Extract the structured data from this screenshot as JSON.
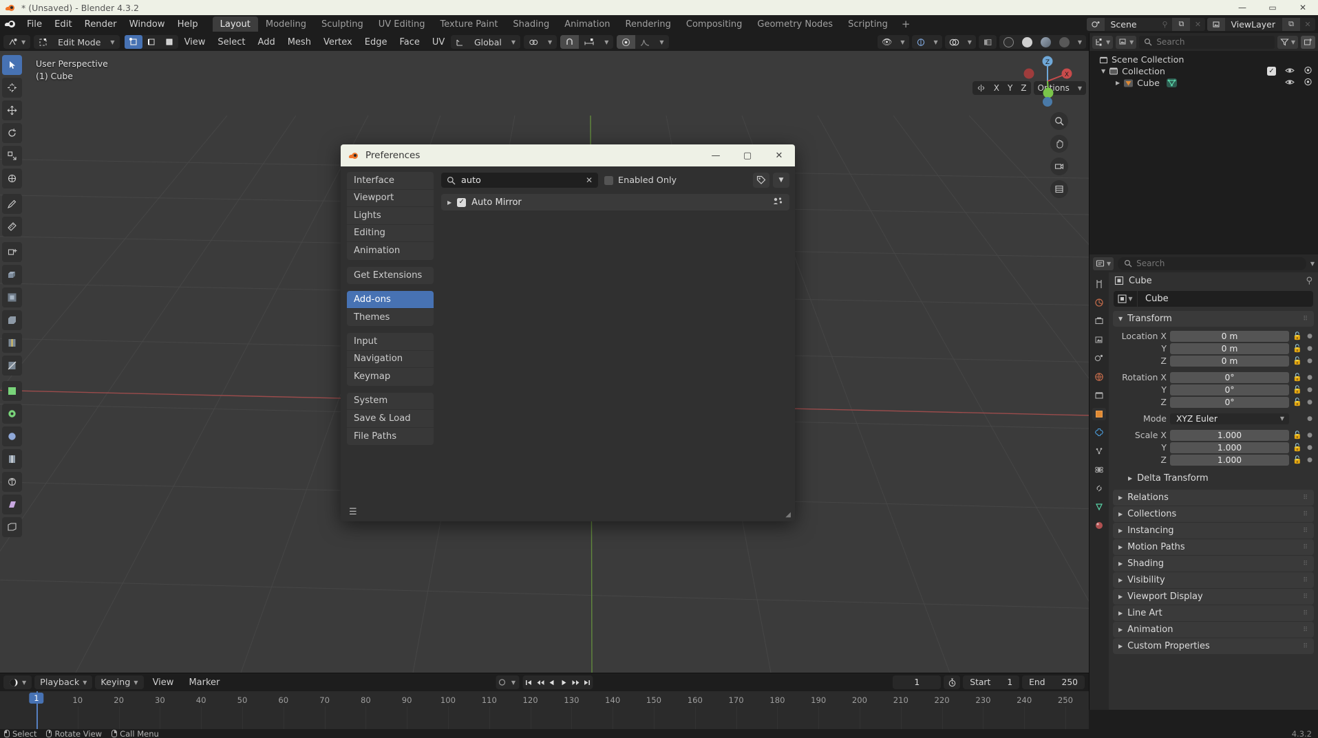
{
  "window": {
    "title": "* (Unsaved) - Blender 4.3.2",
    "minimize": "—",
    "maximize": "▭",
    "close": "✕"
  },
  "topbar": {
    "menus": [
      "File",
      "Edit",
      "Render",
      "Window",
      "Help"
    ],
    "workspaces": [
      {
        "label": "Layout",
        "active": true
      },
      {
        "label": "Modeling",
        "active": false
      },
      {
        "label": "Sculpting",
        "active": false
      },
      {
        "label": "UV Editing",
        "active": false
      },
      {
        "label": "Texture Paint",
        "active": false
      },
      {
        "label": "Shading",
        "active": false
      },
      {
        "label": "Animation",
        "active": false
      },
      {
        "label": "Rendering",
        "active": false
      },
      {
        "label": "Compositing",
        "active": false
      },
      {
        "label": "Geometry Nodes",
        "active": false
      },
      {
        "label": "Scripting",
        "active": false
      }
    ],
    "add_workspace": "+",
    "scene_name": "Scene",
    "viewlayer_name": "ViewLayer",
    "new_scene_icon": "⧉",
    "remove_scene_icon": "✕",
    "new_viewlayer_icon": "⧉",
    "remove_viewlayer_icon": "✕",
    "pin_icon": "⚲"
  },
  "viewport": {
    "mode": "Edit Mode",
    "menus": [
      "View",
      "Select",
      "Add",
      "Mesh",
      "Vertex",
      "Edge",
      "Face",
      "UV"
    ],
    "orientation": "Global",
    "overlay_line1": "User Perspective",
    "overlay_line2": "(1) Cube",
    "options_label": "Options",
    "axis_x": "X",
    "axis_y": "Y",
    "axis_z": "Z",
    "gizmo_x": "X",
    "gizmo_y": "Y",
    "gizmo_z": "Z"
  },
  "outliner": {
    "search_placeholder": "Search",
    "rows": [
      {
        "label": "Scene Collection",
        "level": 0,
        "icon": "collection-icon",
        "expand": "",
        "has_toggles": false
      },
      {
        "label": "Collection",
        "level": 1,
        "icon": "collection-icon",
        "expand": "▼",
        "has_toggles": true,
        "checkbox": true
      },
      {
        "label": "Cube",
        "level": 2,
        "icon": "mesh-object-icon",
        "expand": "▶",
        "has_toggles": true,
        "checkbox": false
      }
    ],
    "eye_icon": "👁",
    "camera_icon": "◉"
  },
  "properties": {
    "search_placeholder": "Search",
    "breadcrumb": "Cube",
    "id_name": "Cube",
    "transform_title": "Transform",
    "fields": [
      {
        "label": "Location X",
        "value": "0 m",
        "lock": true
      },
      {
        "label": "Y",
        "value": "0 m",
        "lock": true
      },
      {
        "label": "Z",
        "value": "0 m",
        "lock": true
      },
      {
        "label": "Rotation X",
        "value": "0°",
        "lock": true,
        "gap": true
      },
      {
        "label": "Y",
        "value": "0°",
        "lock": true
      },
      {
        "label": "Z",
        "value": "0°",
        "lock": true
      },
      {
        "label": "Mode",
        "value": "XYZ Euler",
        "lock": false,
        "dropdown": true,
        "gap": true
      },
      {
        "label": "Scale X",
        "value": "1.000",
        "lock": true,
        "gap": true
      },
      {
        "label": "Y",
        "value": "1.000",
        "lock": true
      },
      {
        "label": "Z",
        "value": "1.000",
        "lock": true
      }
    ],
    "delta_transform": "Delta Transform",
    "panels": [
      "Relations",
      "Collections",
      "Instancing",
      "Motion Paths",
      "Shading",
      "Visibility",
      "Viewport Display",
      "Line Art",
      "Animation",
      "Custom Properties"
    ]
  },
  "timeline": {
    "playback": "Playback",
    "keying": "Keying",
    "view": "View",
    "marker": "Marker",
    "current_frame": "1",
    "start_label": "Start",
    "start_value": "1",
    "end_label": "End",
    "end_value": "250",
    "ticks": [
      "1",
      "10",
      "20",
      "30",
      "40",
      "50",
      "60",
      "70",
      "80",
      "90",
      "100",
      "110",
      "120",
      "130",
      "140",
      "150",
      "160",
      "170",
      "180",
      "190",
      "200",
      "210",
      "220",
      "230",
      "240",
      "250"
    ],
    "playhead_frame": "1"
  },
  "statusbar": {
    "hints": [
      {
        "button": "l",
        "label": "Select"
      },
      {
        "button": "m",
        "label": "Rotate View"
      },
      {
        "button": "r",
        "label": "Call Menu"
      }
    ],
    "version": "4.3.2"
  },
  "preferences": {
    "title": "Preferences",
    "minimize": "—",
    "maximize": "▢",
    "close": "✕",
    "nav_groups": [
      {
        "items": [
          {
            "label": "Interface",
            "active": false
          },
          {
            "label": "Viewport",
            "active": false
          },
          {
            "label": "Lights",
            "active": false
          },
          {
            "label": "Editing",
            "active": false
          },
          {
            "label": "Animation",
            "active": false
          }
        ]
      },
      {
        "items": [
          {
            "label": "Get Extensions",
            "active": false
          }
        ]
      },
      {
        "items": [
          {
            "label": "Add-ons",
            "active": true
          },
          {
            "label": "Themes",
            "active": false
          }
        ]
      },
      {
        "items": [
          {
            "label": "Input",
            "active": false
          },
          {
            "label": "Navigation",
            "active": false
          },
          {
            "label": "Keymap",
            "active": false
          }
        ]
      },
      {
        "items": [
          {
            "label": "System",
            "active": false
          },
          {
            "label": "Save & Load",
            "active": false
          },
          {
            "label": "File Paths",
            "active": false
          }
        ]
      }
    ],
    "search_value": "auto",
    "search_clear": "✕",
    "enabled_only_label": "Enabled Only",
    "enabled_only_checked": false,
    "tag_icon": "🏷",
    "dropdown_icon": "⌄",
    "addons": [
      {
        "name": "Auto Mirror",
        "enabled": true,
        "expand": "▶",
        "right_icon": "community-icon"
      }
    ],
    "menu_icon": "☰",
    "resize_icon": "◢"
  },
  "colors": {
    "accent_blue": "#4772b3",
    "titlebar_light": "#eef1e6",
    "panel_bg": "#303030",
    "editor_bg": "#1d1d1d",
    "viewport_bg": "#3b3b3b",
    "axis_x_red": "#9c4c4c",
    "axis_y_green": "#6a9c3c",
    "blender_orange": "#f0762b"
  }
}
